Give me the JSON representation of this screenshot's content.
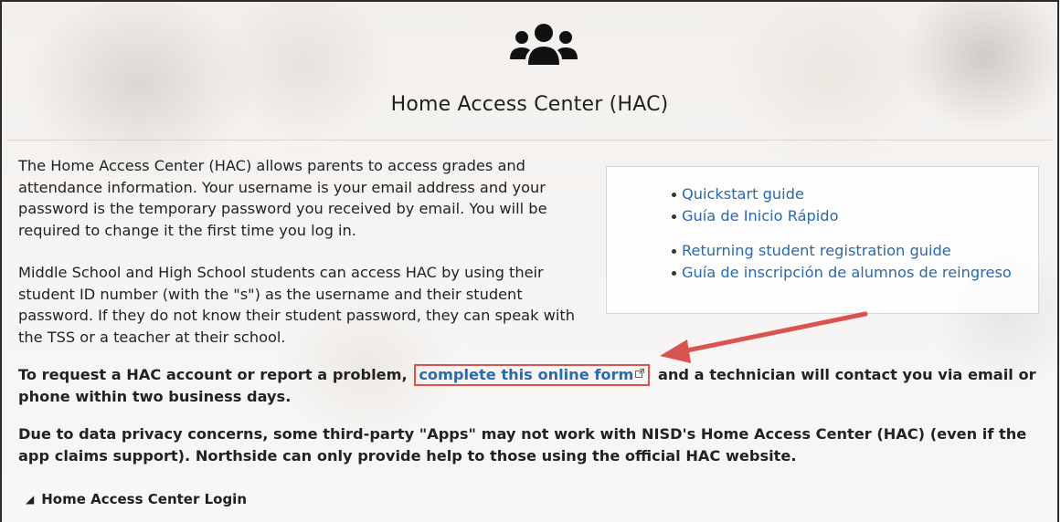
{
  "header": {
    "icon": "users-icon",
    "title": "Home Access Center (HAC)"
  },
  "intro": {
    "paragraph1": "The Home Access Center (HAC) allows parents to access grades and attendance information. Your username is your email address and your password is the temporary password you received by email. You will be required to change it the first time you log in.",
    "paragraph2": "Middle School and High School students can access HAC by using their student ID number (with the \"s\") as the username and their student password. If they do not know their student password, they can speak with the TSS or a teacher at their school."
  },
  "guides": {
    "group1": [
      "Quickstart guide",
      "Guía de Inicio Rápido"
    ],
    "group2": [
      "Returning student registration guide",
      "Guía de inscripción de alumnos de reingreso"
    ]
  },
  "request": {
    "before": "To request a HAC account or report a problem, ",
    "link_text": "complete this online form",
    "after": " and a technician will contact you via email or phone within two business days."
  },
  "privacy": {
    "text": "Due to data privacy concerns, some third-party \"Apps\" may not work with NISD's Home Access Center (HAC) (even if the app claims support). Northside can only provide help to those using the official HAC website."
  },
  "login_section": {
    "label": "Home Access Center Login",
    "icon": "triangle-collapse-icon"
  },
  "colors": {
    "link": "#2a6aa8",
    "highlight_box": "#d9534f",
    "arrow": "#d9534f"
  }
}
